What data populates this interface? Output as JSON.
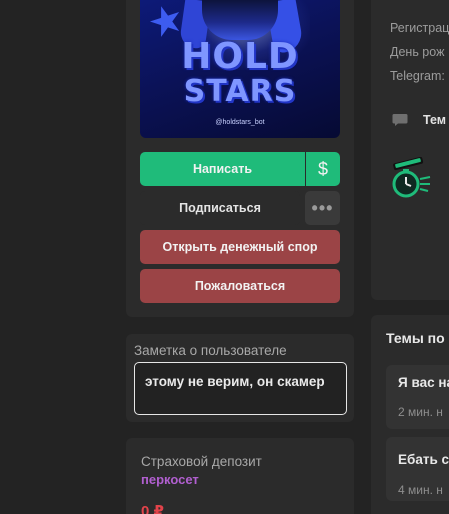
{
  "profile": {
    "avatar": {
      "logo_line1": "HOLD",
      "logo_line2": "STARS",
      "handle": "@holdstars_bot"
    },
    "buttons": {
      "write": "Написать",
      "money": "$",
      "subscribe": "Подписаться",
      "more": "•••",
      "dispute": "Открыть денежный спор",
      "report": "Пожаловаться"
    }
  },
  "note": {
    "title": "Заметка о пользователе",
    "text": "этому не верим, он скамер"
  },
  "deposit": {
    "title": "Страховой депозит",
    "value": "перкосет",
    "amount": "0 ₽"
  },
  "info": {
    "registered_label": "Регистрац",
    "birthday_label": "День рож",
    "telegram_label": "Telegram:",
    "topic_label": "Тем",
    "icons": [
      "chat-bubble-icon",
      "stopwatch-badge-icon"
    ]
  },
  "topics": {
    "title": "Темы по",
    "items": [
      {
        "title": "Я вас на",
        "time": "2 мин. н"
      },
      {
        "title": "Ебать с",
        "time": "4 мин. н"
      }
    ]
  },
  "colors": {
    "background": "#232323",
    "panel": "#2b2b2b",
    "green": "#1fbb7a",
    "red_button": "#9b4446",
    "purple_link": "#b15fd0",
    "amount_red": "#e2434a"
  }
}
